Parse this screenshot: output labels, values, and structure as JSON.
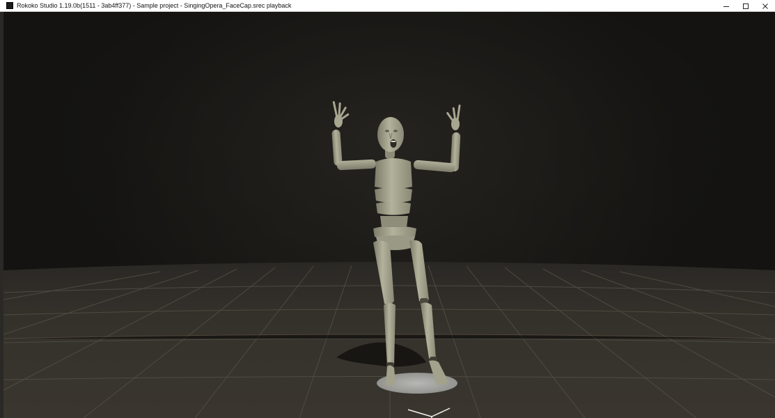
{
  "window": {
    "title": "Rokoko Studio 1.19.0b(1511 - 3ab4ff377) - Sample project - SingingOpera_FaceCap.srec playback",
    "app_icon": "rokoko-app-icon",
    "controls": {
      "minimize": "minimize-icon",
      "maximize": "maximize-icon",
      "close": "close-icon"
    }
  },
  "viewport": {
    "scene": "3d-character-playback",
    "floor": "grid-floor",
    "character": "mannequin-figure",
    "gizmo": "axis-gizmo-icon",
    "colors": {
      "background": "#1a1916",
      "floor": "#34312b",
      "grid_line": "#56534b",
      "mannequin": "#a9a892",
      "pedestal": "#a3a3a0"
    }
  }
}
